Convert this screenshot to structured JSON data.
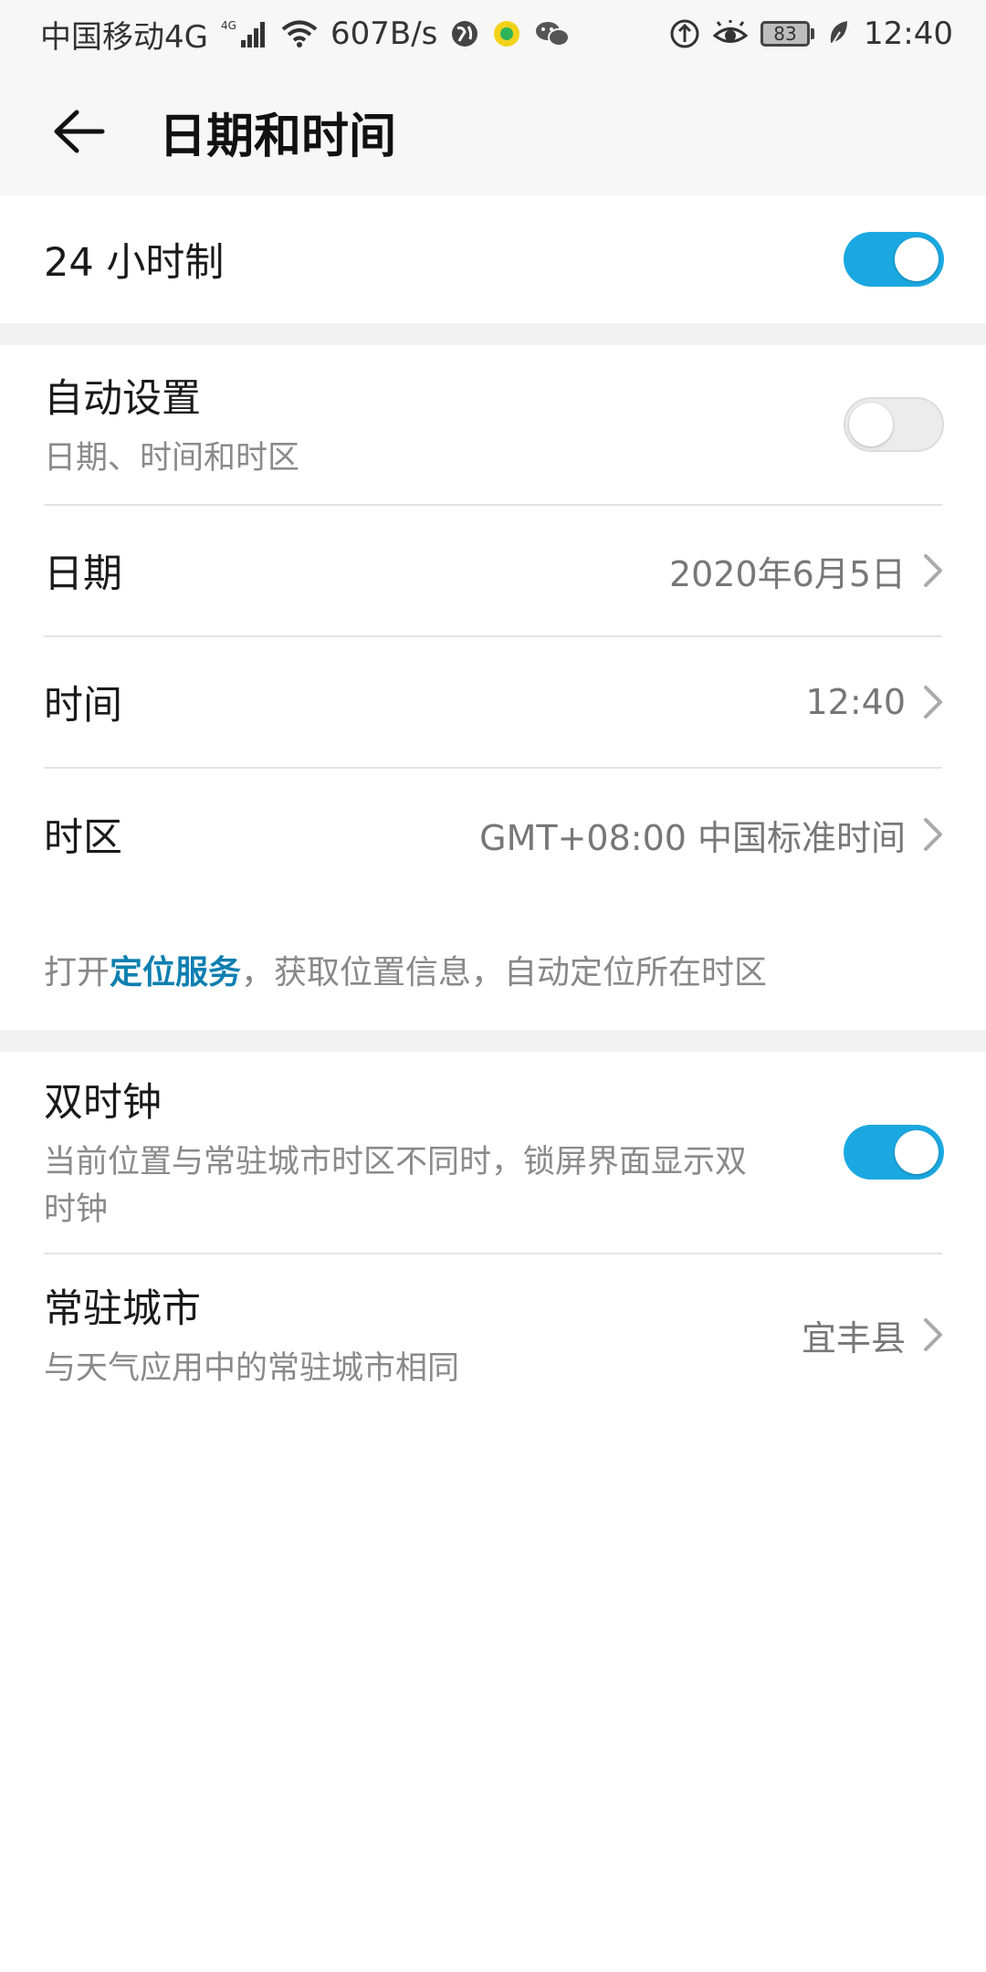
{
  "status_bar": {
    "carrier": "中国移动4G",
    "net_badge": "4G",
    "speed": "607B/s",
    "battery": "83",
    "time": "12:40"
  },
  "header": {
    "title": "日期和时间"
  },
  "settings": {
    "hour24": {
      "label": "24 小时制",
      "enabled": true
    },
    "auto_set": {
      "label": "自动设置",
      "sub": "日期、时间和时区",
      "enabled": false
    },
    "date": {
      "label": "日期",
      "value": "2020年6月5日"
    },
    "time": {
      "label": "时间",
      "value": "12:40"
    },
    "timezone": {
      "label": "时区",
      "value": "GMT+08:00 中国标准时间"
    },
    "location_hint": {
      "prefix": "打开",
      "link": "定位服务",
      "suffix": "，获取位置信息，自动定位所在时区"
    },
    "dual_clock": {
      "label": "双时钟",
      "sub": "当前位置与常驻城市时区不同时，锁屏界面显示双时钟",
      "enabled": true
    },
    "home_city": {
      "label": "常驻城市",
      "sub": "与天气应用中的常驻城市相同",
      "value": "宜丰县"
    }
  },
  "colors": {
    "accent": "#1ba8e0",
    "link": "#0d7fb0"
  }
}
